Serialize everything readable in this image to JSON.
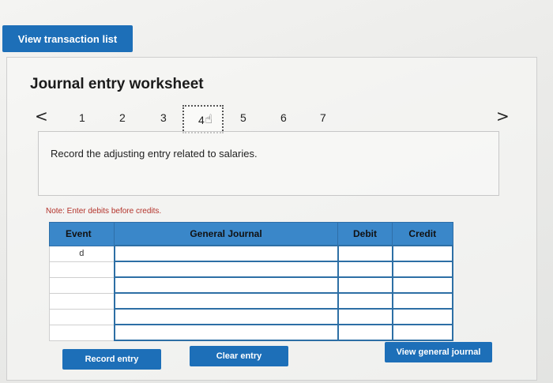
{
  "top_button": "View transaction list",
  "title": "Journal entry worksheet",
  "nav": {
    "prev": "<",
    "next": ">",
    "steps": [
      "1",
      "2",
      "3",
      "4",
      "5",
      "6",
      "7"
    ],
    "current_step": "4"
  },
  "instruction": "Record the adjusting entry related to salaries.",
  "note": "Note: Enter debits before credits.",
  "table": {
    "headers": [
      "Event",
      "General Journal",
      "Debit",
      "Credit"
    ],
    "rows": [
      {
        "event": "d"
      },
      {
        "event": ""
      },
      {
        "event": ""
      },
      {
        "event": ""
      },
      {
        "event": ""
      },
      {
        "event": ""
      }
    ]
  },
  "buttons": {
    "record": "Record entry",
    "clear": "Clear entry",
    "view_general": "View general journal"
  },
  "colors": {
    "primary": "#1d6fb8",
    "header": "#3a87c9",
    "note": "#b3322a"
  }
}
